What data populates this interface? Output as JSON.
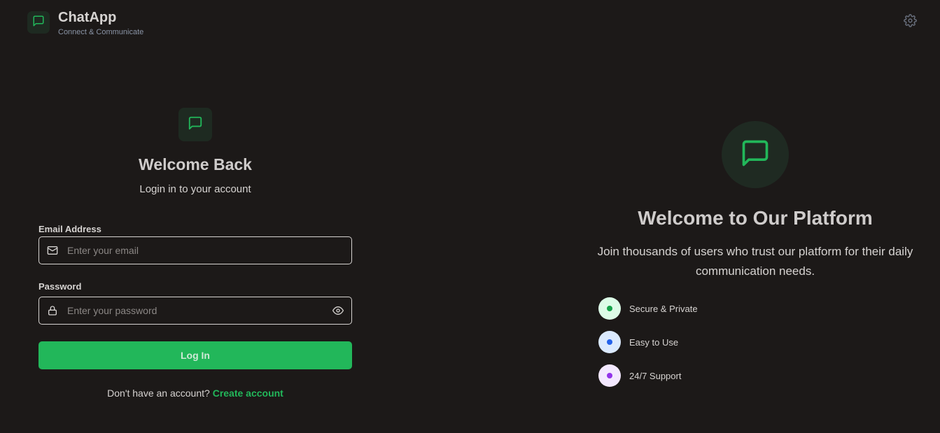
{
  "header": {
    "app_name": "ChatApp",
    "tagline": "Connect & Communicate",
    "logo_icon": "message-square-icon",
    "settings_icon": "gear-icon"
  },
  "login": {
    "title": "Welcome Back",
    "subtitle": "Login in to your account",
    "email": {
      "label": "Email Address",
      "placeholder": "Enter your email",
      "value": "",
      "icon": "mail-icon"
    },
    "password": {
      "label": "Password",
      "placeholder": "Enter your password",
      "value": "",
      "icon": "lock-icon",
      "toggle_icon": "eye-icon"
    },
    "submit_label": "Log In",
    "signup_prompt": "Don't have an account?",
    "signup_link": "Create account"
  },
  "hero": {
    "title": "Welcome to Our Platform",
    "description": "Join thousands of users who trust our platform for their daily communication needs.",
    "features": [
      {
        "label": "Secure & Private",
        "bg": "#dcfce7",
        "dot": "#16a34a"
      },
      {
        "label": "Easy to Use",
        "bg": "#dbeafe",
        "dot": "#2563eb"
      },
      {
        "label": "24/7 Support",
        "bg": "#f3e8ff",
        "dot": "#9333ea"
      }
    ]
  },
  "colors": {
    "background": "#1c1918",
    "accent": "#22b75a"
  }
}
